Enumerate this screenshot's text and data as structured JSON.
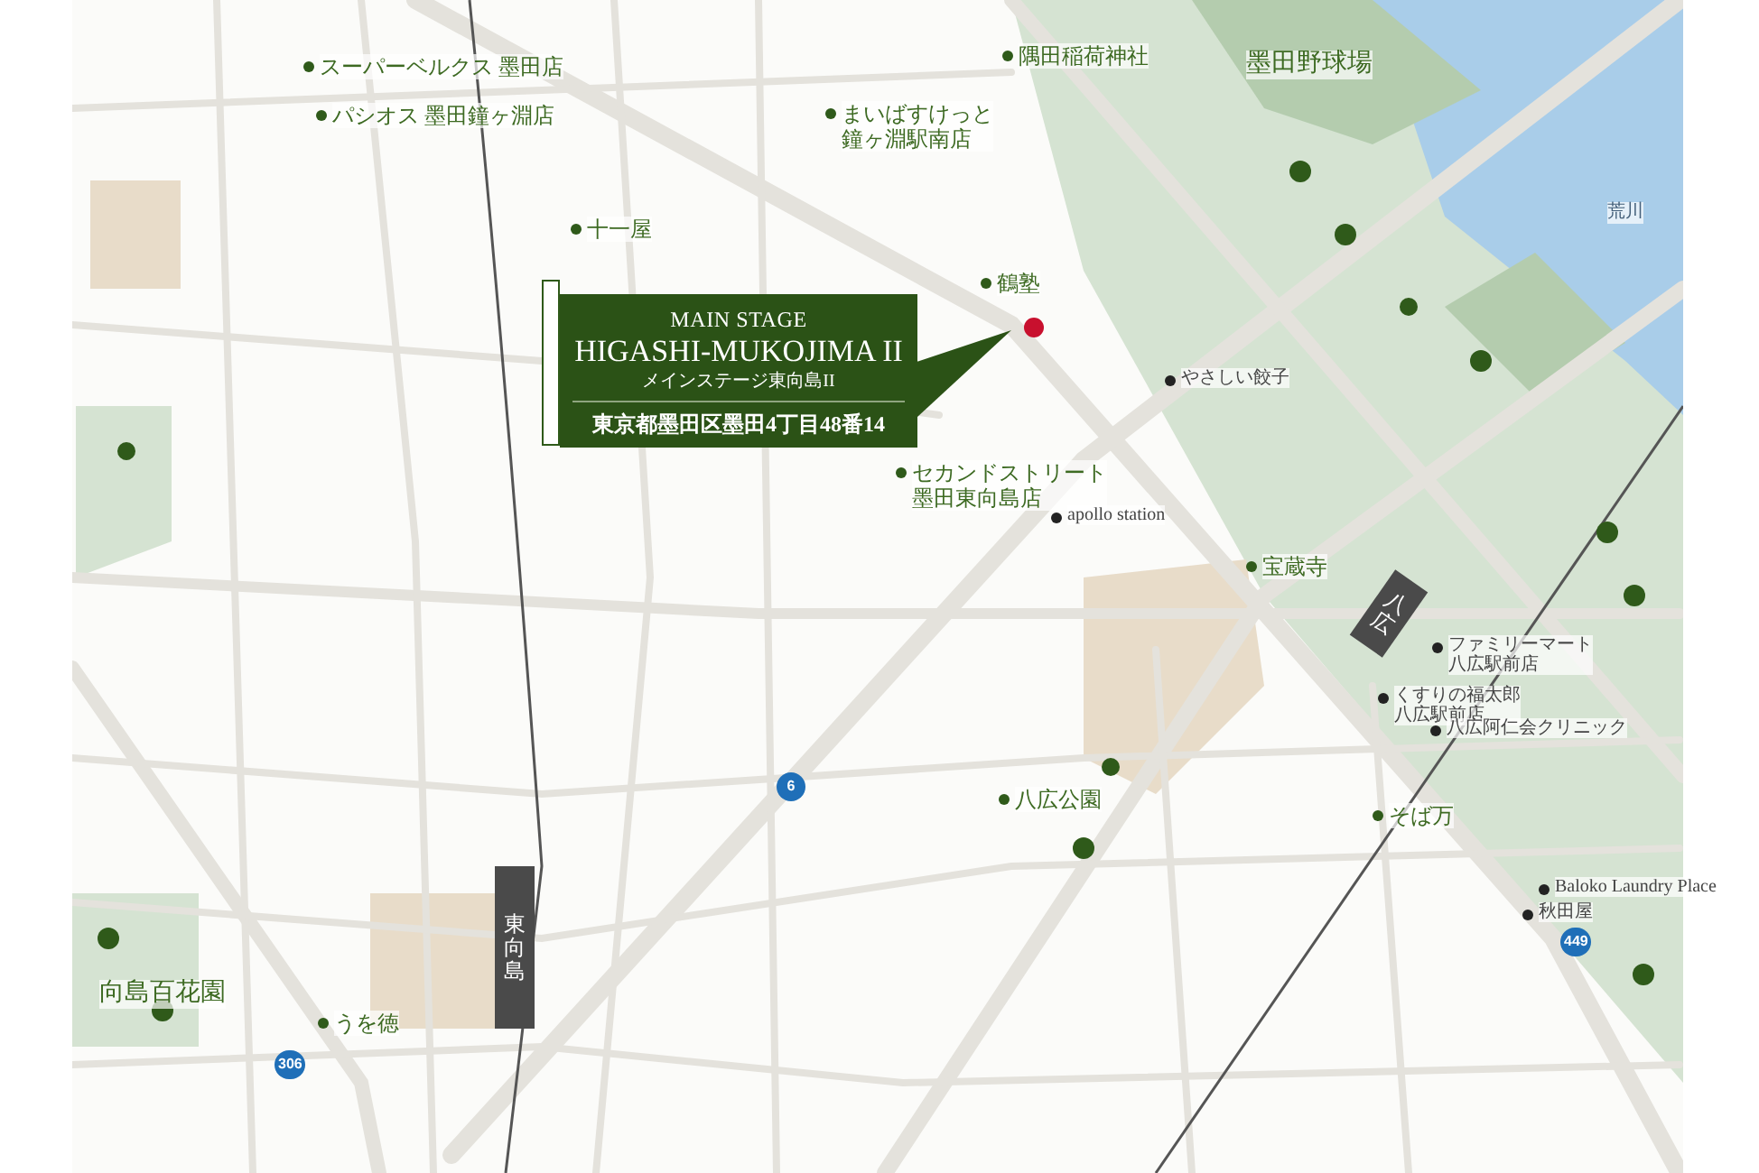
{
  "info_box": {
    "title": "MAIN STAGE",
    "name": "HIGASHI-MUKOJIMA II",
    "subtitle": "メインステージ東向島II",
    "address": "東京都墨田区墨田4丁目48番14"
  },
  "places": [
    {
      "kind": "major",
      "lines": [
        "スーパーベルクス 墨田店"
      ]
    },
    {
      "kind": "major",
      "lines": [
        "パシオス 墨田鐘ヶ淵店"
      ]
    },
    {
      "kind": "major",
      "lines": [
        "十一屋"
      ]
    },
    {
      "kind": "major",
      "lines": [
        "隅田稲荷神社"
      ]
    },
    {
      "kind": "major",
      "lines": [
        "まいばすけっと",
        "鐘ヶ淵駅南店"
      ]
    },
    {
      "kind": "major",
      "lines": [
        "鶴塾"
      ]
    },
    {
      "kind": "major",
      "lines": [
        "セカンドストリート",
        "墨田東向島店"
      ]
    },
    {
      "kind": "major",
      "lines": [
        "宝蔵寺"
      ]
    },
    {
      "kind": "major",
      "lines": [
        "八広公園"
      ]
    },
    {
      "kind": "major",
      "lines": [
        "そば万"
      ]
    },
    {
      "kind": "major",
      "lines": [
        "うを徳"
      ]
    },
    {
      "kind": "area",
      "lines": [
        "向島百花園"
      ]
    },
    {
      "kind": "area",
      "lines": [
        "墨田野球場"
      ]
    },
    {
      "kind": "water",
      "lines": [
        "荒川"
      ]
    },
    {
      "kind": "minor",
      "lines": [
        "やさしい餃子"
      ]
    },
    {
      "kind": "minor",
      "lines": [
        "apollo station"
      ]
    },
    {
      "kind": "minor",
      "lines": [
        "ファミリーマート",
        "八広駅前店"
      ]
    },
    {
      "kind": "minor",
      "lines": [
        "くすりの福太郎",
        "八広駅前店"
      ]
    },
    {
      "kind": "minor",
      "lines": [
        "八広阿仁会クリニック"
      ]
    },
    {
      "kind": "minor",
      "lines": [
        "Baloko Laundry Place"
      ]
    },
    {
      "kind": "minor",
      "lines": [
        "秋田屋"
      ]
    }
  ],
  "stations": [
    {
      "name": "東向島"
    },
    {
      "name": "八広"
    }
  ],
  "route_shields": [
    {
      "number": "6"
    },
    {
      "number": "306"
    },
    {
      "number": "449"
    }
  ]
}
